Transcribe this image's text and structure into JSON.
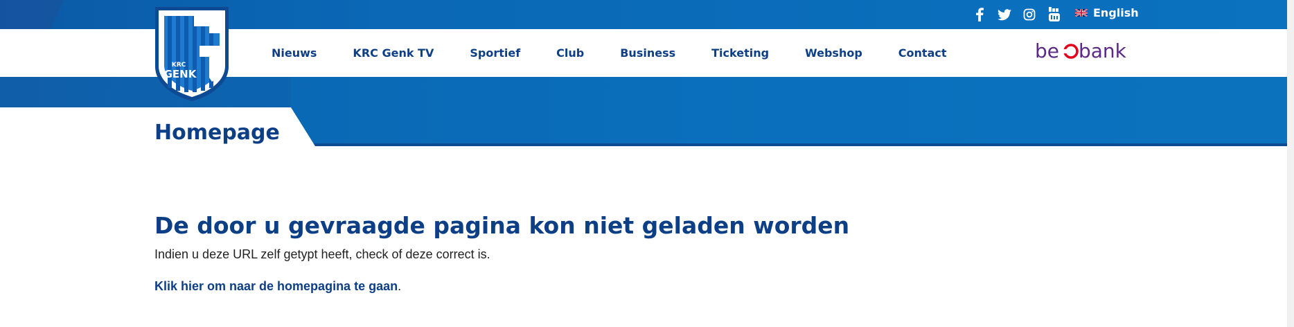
{
  "header": {
    "social": [
      {
        "icon": "facebook-icon"
      },
      {
        "icon": "twitter-icon"
      },
      {
        "icon": "instagram-icon"
      },
      {
        "icon": "youtube-icon"
      }
    ],
    "language": {
      "label": "English",
      "flag": "uk-flag-icon"
    }
  },
  "logo": {
    "line1": "KRC",
    "line2": "GENK"
  },
  "nav": {
    "items": [
      "Nieuws",
      "KRC Genk TV",
      "Sportief",
      "Club",
      "Business",
      "Ticketing",
      "Webshop",
      "Contact"
    ]
  },
  "sponsor": {
    "text_a": "be",
    "text_b": "bank"
  },
  "page": {
    "title": "Homepage"
  },
  "error": {
    "title": "De door u gevraagde pagina kon niet geladen worden",
    "text": "Indien u deze URL zelf getypt heeft, check of deze correct is.",
    "link_label": "Klik hier om naar de homepagina te gaan",
    "link_suffix": "."
  },
  "colors": {
    "brand_blue": "#0a6cb8",
    "dark_blue": "#0d3f86",
    "sponsor_purple": "#5b2a86",
    "sponsor_red": "#e2001a"
  }
}
